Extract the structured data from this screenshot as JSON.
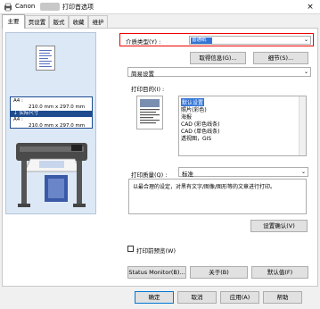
{
  "window": {
    "title_prefix": "Canon",
    "title_suffix": "打印首选项",
    "close_glyph": "×"
  },
  "tabs": [
    {
      "label": "主要"
    },
    {
      "label": "页设置"
    },
    {
      "label": "版式"
    },
    {
      "label": "收藏"
    },
    {
      "label": "维护"
    }
  ],
  "preview": {
    "size_rows": [
      "A4 :",
      "210.0 mm x 297.0 mm",
      "实际尺寸",
      "A4 :",
      "210.0 mm x 297.0 mm"
    ]
  },
  "media": {
    "label": "介质类型(Y) :",
    "value": "普通纸",
    "get_info_button": "取得信息(G)...",
    "details_button": "细节(S)..."
  },
  "settings_mode": {
    "value": "简易设置"
  },
  "print_target": {
    "label": "打印目的(I) :",
    "items": [
      "默认设置",
      "照片(彩色)",
      "海报",
      "CAD (彩色线条)",
      "CAD (单色线条)",
      "透视图，GIS"
    ]
  },
  "quality": {
    "label": "打印质量(Q) :",
    "value": "标准",
    "description": "以最合理的设定，对黑有文字/图像/图形等的文章进行打印。",
    "confirm_button": "设置确认(V)"
  },
  "print_preview": {
    "label": "打印前预览(W)"
  },
  "footer_buttons": {
    "status_monitor": "Status Monitor(B)...",
    "about": "关于(B)",
    "defaults": "默认值(F)"
  },
  "dialog_buttons": {
    "ok": "确定",
    "cancel": "取消",
    "apply": "应用(A)",
    "help": "帮助"
  },
  "colors": {
    "accent": "#3375d7",
    "highlight_border": "#e00000",
    "panel_bg": "#dce8f5"
  }
}
